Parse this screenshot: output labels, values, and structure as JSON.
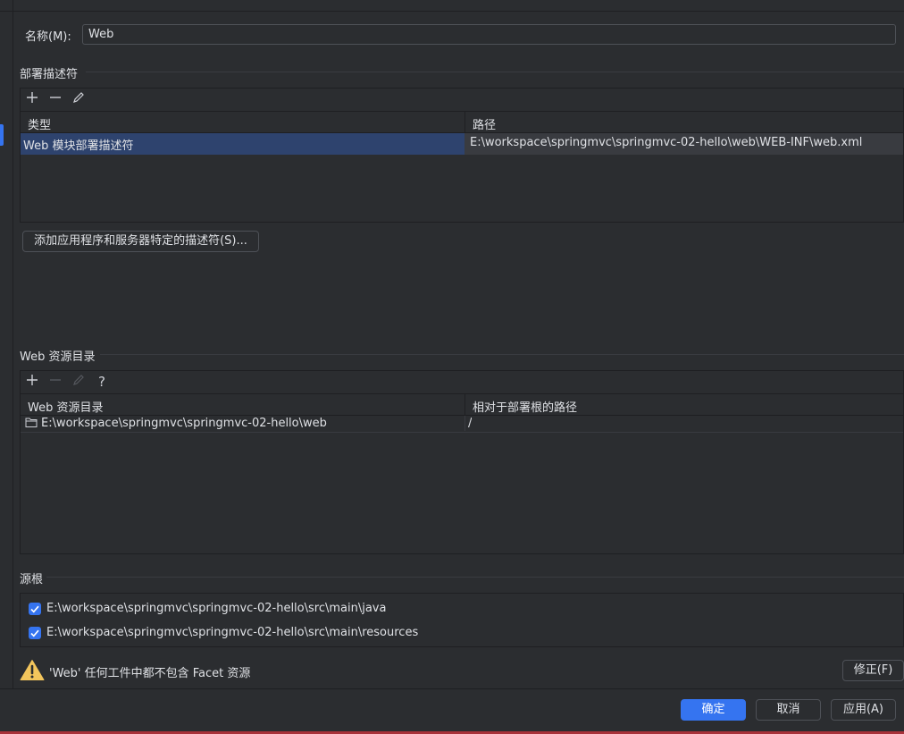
{
  "colors": {
    "accent": "#3574f0",
    "selection": "#2e436e",
    "warning": "#f2c55c",
    "background": "#2b2d30"
  },
  "name_field": {
    "label": "名称(M):",
    "value": "Web"
  },
  "deployment": {
    "section_title": "部署描述符",
    "toolbar": {
      "add_icon": "plus-icon",
      "remove_icon": "minus-icon",
      "edit_icon": "pencil-icon"
    },
    "columns": [
      "类型",
      "路径"
    ],
    "rows": [
      {
        "type": "Web 模块部署描述符",
        "path": "E:\\workspace\\springmvc\\springmvc-02-hello\\web\\WEB-INF\\web.xml"
      }
    ],
    "add_button_label": "添加应用程序和服务器特定的描述符(S)..."
  },
  "web_resources": {
    "section_title": "Web 资源目录",
    "toolbar": {
      "add_icon": "plus-icon",
      "remove_icon": "minus-icon",
      "edit_icon": "pencil-icon",
      "help_icon": "question-icon"
    },
    "columns": [
      "Web 资源目录",
      "相对于部署根的路径"
    ],
    "rows": [
      {
        "dir": "E:\\workspace\\springmvc\\springmvc-02-hello\\web",
        "relative": "/"
      }
    ]
  },
  "source_roots": {
    "section_title": "源根",
    "items": [
      {
        "checked": true,
        "path": "E:\\workspace\\springmvc\\springmvc-02-hello\\src\\main\\java"
      },
      {
        "checked": true,
        "path": "E:\\workspace\\springmvc\\springmvc-02-hello\\src\\main\\resources"
      }
    ]
  },
  "warning": {
    "icon": "warning-icon",
    "text": "'Web' 任何工件中都不包含 Facet 资源",
    "fix_label": "修正(F)"
  },
  "footer": {
    "ok_label": "确定",
    "cancel_label": "取消",
    "apply_label": "应用(A)"
  }
}
